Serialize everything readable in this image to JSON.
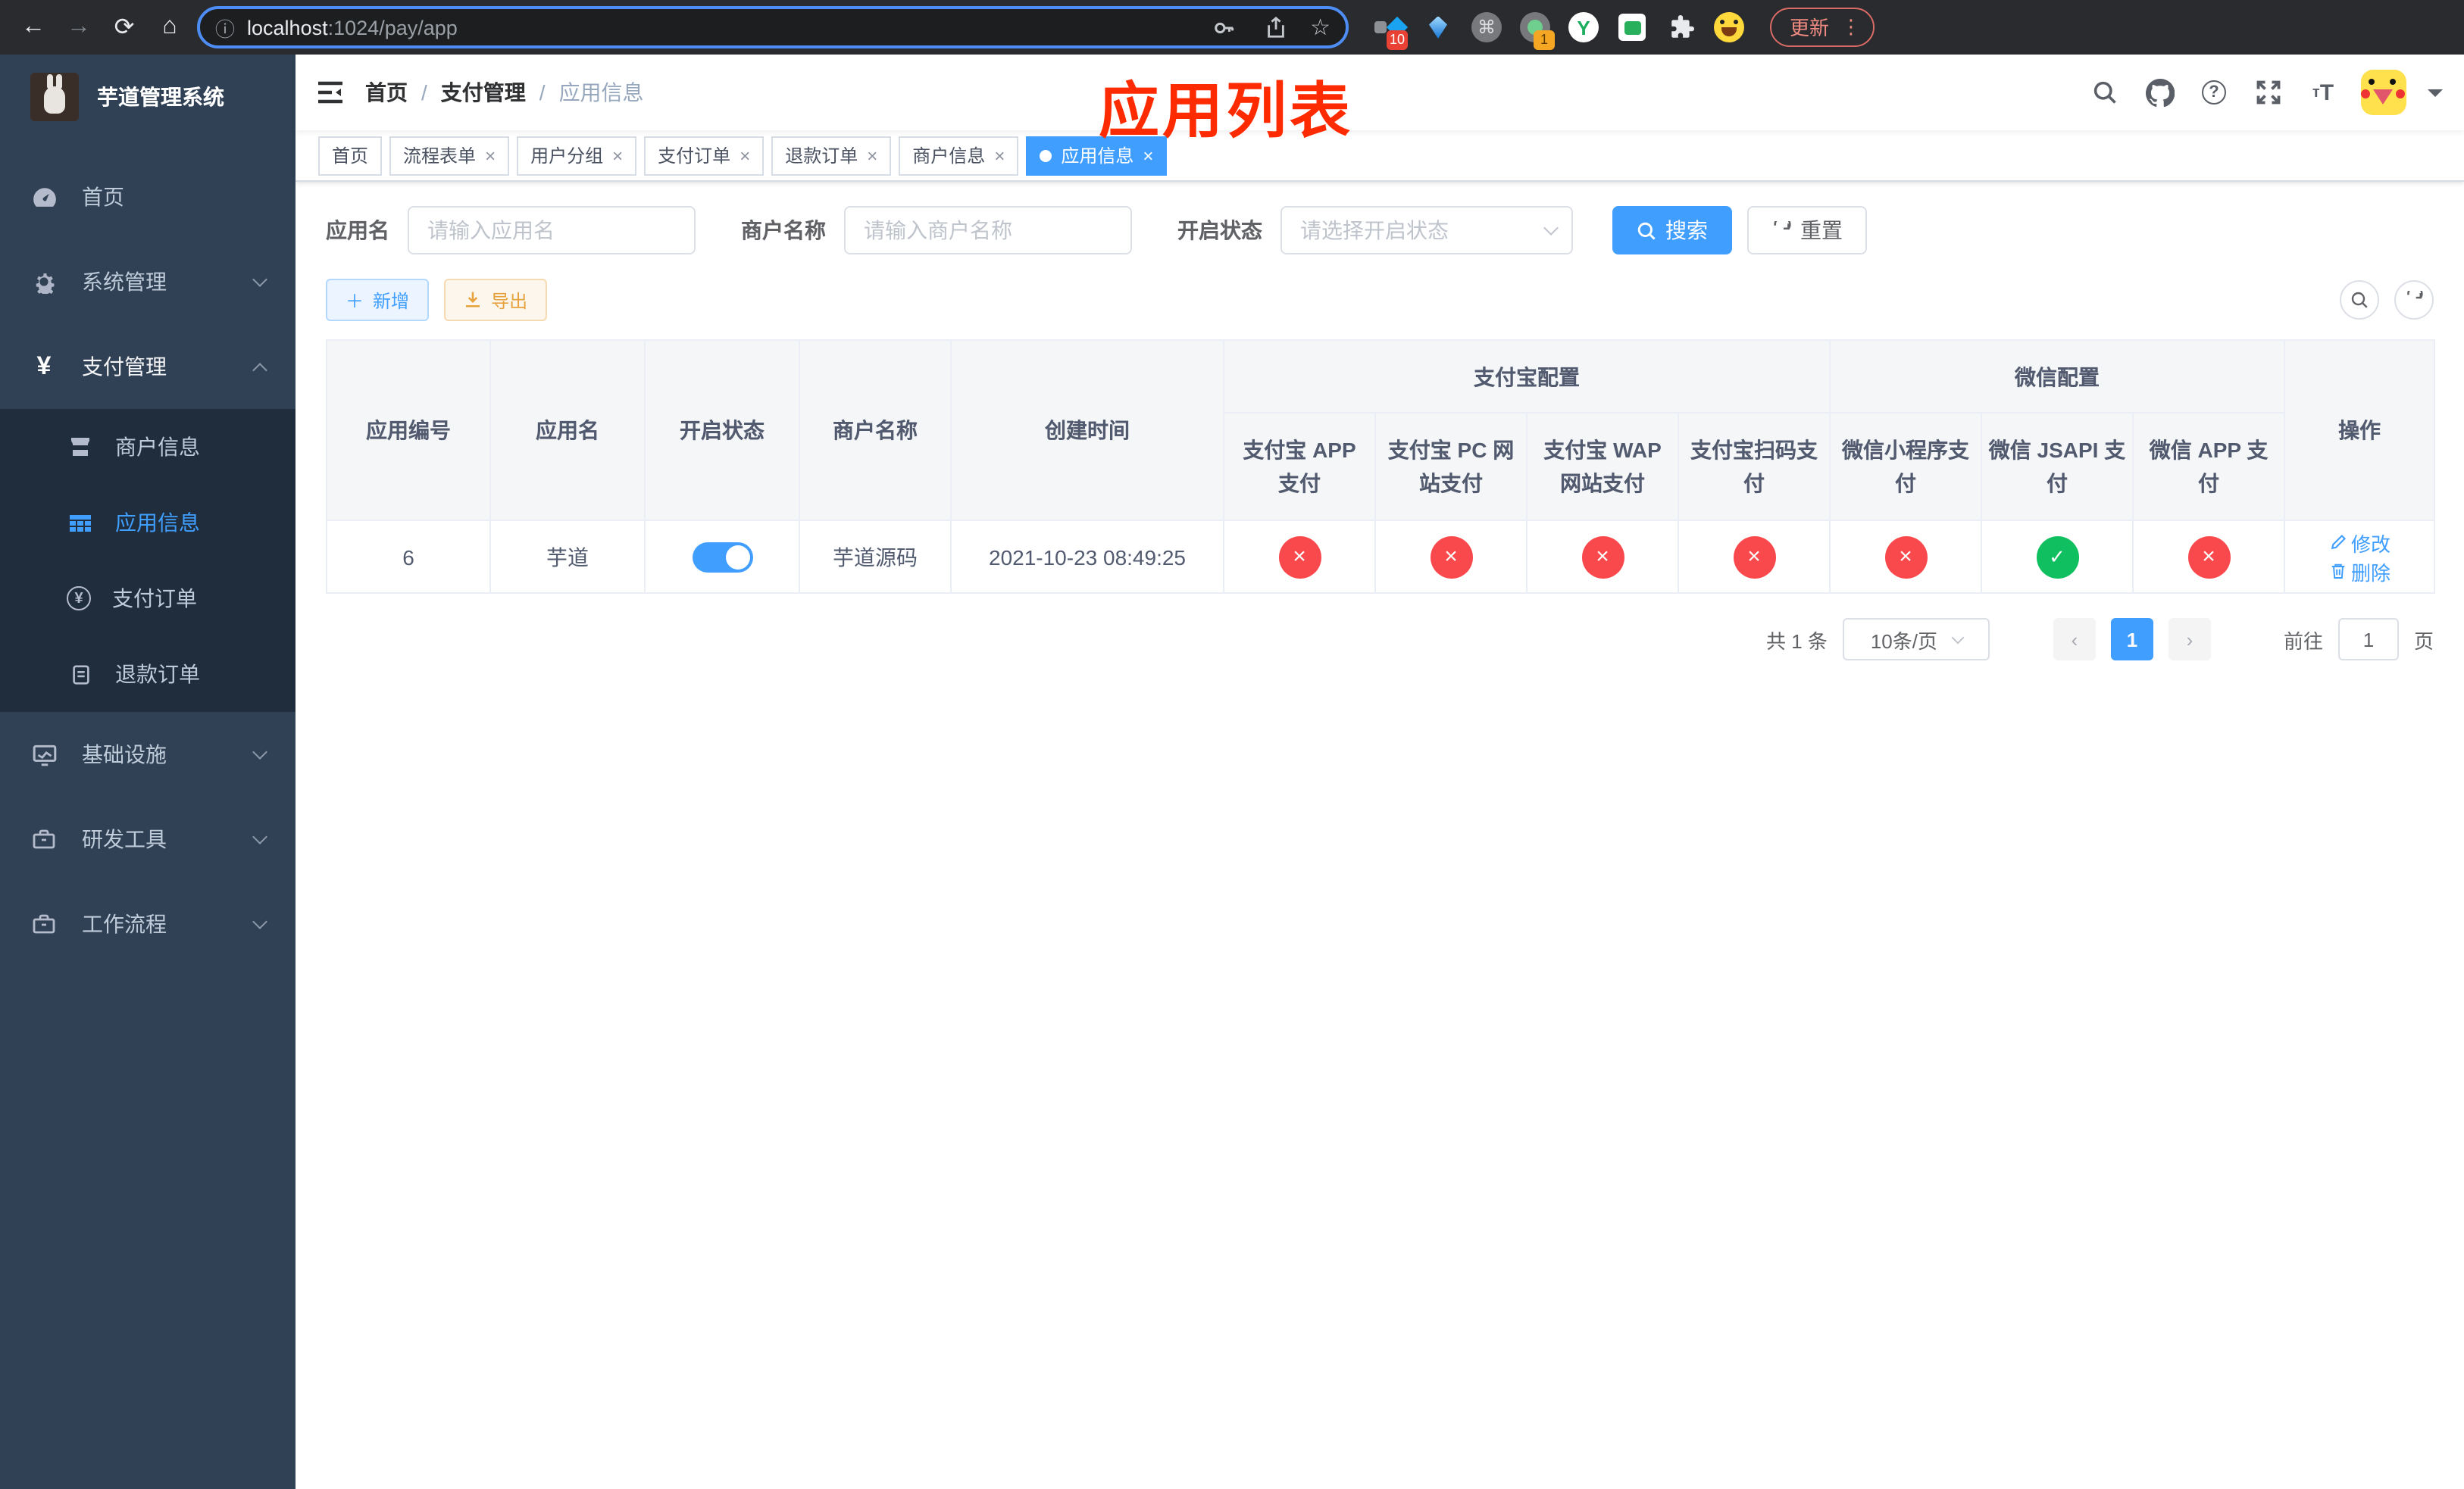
{
  "colors": {
    "accent": "#409eff",
    "danger": "#f9494c",
    "success": "#0fbf60",
    "annotation": "#ff2b00",
    "sidebar_bg": "#304156",
    "submenu_bg": "#1f2d3d"
  },
  "icons": {
    "close": "×",
    "back": "←",
    "forward": "→",
    "reload": "⟳",
    "home": "⌂",
    "info": "ⓘ",
    "star": "☆",
    "command": "⌘",
    "dots_vertical": "⋮",
    "prev": "‹",
    "next": "›",
    "puzzle_hint": "puzzle-piece",
    "y_extension": "Y"
  },
  "browser": {
    "url_host": "localhost",
    "url_rest": ":1024/pay/app",
    "ext_badge_blue": "10",
    "ext_badge_dot": "1",
    "update_label": "更新"
  },
  "sidebar": {
    "app_title": "芋道管理系统",
    "items": [
      {
        "label": "首页"
      },
      {
        "label": "系统管理"
      },
      {
        "label": "支付管理"
      },
      {
        "label": "基础设施"
      },
      {
        "label": "研发工具"
      },
      {
        "label": "工作流程"
      }
    ],
    "payment_children": [
      {
        "label": "商户信息"
      },
      {
        "label": "应用信息"
      },
      {
        "label": "支付订单"
      },
      {
        "label": "退款订单"
      }
    ]
  },
  "breadcrumb": {
    "items": [
      "首页",
      "支付管理",
      "应用信息"
    ]
  },
  "annotation": {
    "text": "应用列表"
  },
  "tags": [
    {
      "label": "首页"
    },
    {
      "label": "流程表单"
    },
    {
      "label": "用户分组"
    },
    {
      "label": "支付订单"
    },
    {
      "label": "退款订单"
    },
    {
      "label": "商户信息"
    },
    {
      "label": "应用信息"
    }
  ],
  "filters": {
    "app_name_label": "应用名",
    "app_name_placeholder": "请输入应用名",
    "merchant_label": "商户名称",
    "merchant_placeholder": "请输入商户名称",
    "status_label": "开启状态",
    "status_placeholder": "请选择开启状态",
    "search_label": "搜索",
    "reset_label": "重置"
  },
  "toolbar": {
    "add_label": "新增",
    "export_label": "导出"
  },
  "table": {
    "columns": {
      "app_id": "应用编号",
      "app_name": "应用名",
      "status": "开启状态",
      "merchant": "商户名称",
      "created": "创建时间",
      "alipay_group": "支付宝配置",
      "wechat_group": "微信配置",
      "actions": "操作"
    },
    "alipay_cols": [
      "支付宝 APP 支付",
      "支付宝 PC 网站支付",
      "支付宝 WAP 网站支付",
      "支付宝扫码支付"
    ],
    "wechat_cols": [
      "微信小程序支付",
      "微信 JSAPI 支付",
      "微信 APP 支付"
    ],
    "row": {
      "app_id": "6",
      "app_name": "芋道",
      "enabled": true,
      "merchant": "芋道源码",
      "created": "2021-10-23 08:49:25",
      "configs": [
        false,
        false,
        false,
        false,
        false,
        true,
        false
      ],
      "edit_label": "修改",
      "delete_label": "删除"
    }
  },
  "pagination": {
    "total": "共 1 条",
    "page_size": "10条/页",
    "current": "1",
    "goto_label": "前往",
    "goto_value": "1",
    "page_unit": "页"
  }
}
